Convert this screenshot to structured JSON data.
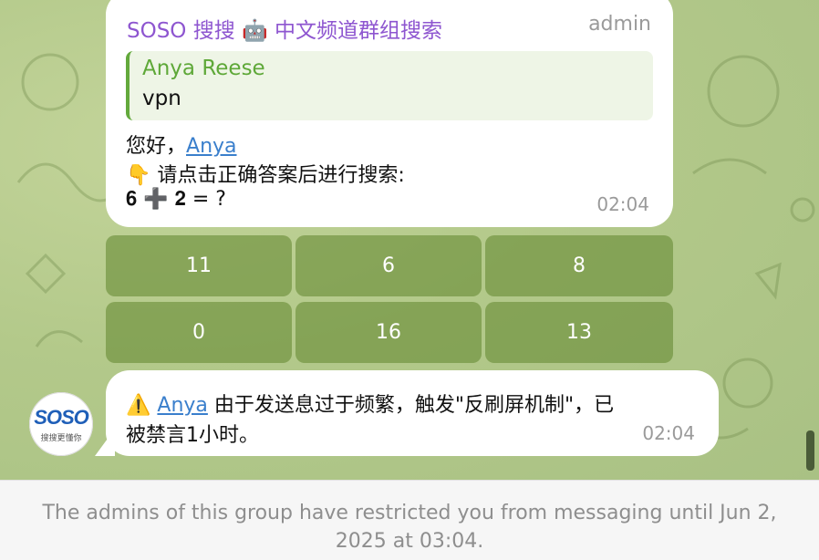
{
  "colors": {
    "chat_background": "#b3c98a",
    "sender_name": "#8e56d0",
    "quote_name": "#5ea838",
    "link": "#3a7fcc",
    "keyboard_button": "#698c37"
  },
  "message1": {
    "sender": "SOSO 搜搜 🤖 中文频道群组搜索",
    "role": "admin",
    "reply_quote": {
      "name": "Anya Reese",
      "text": "vpn"
    },
    "greeting_prefix": "您好，",
    "greeting_link": "Anya",
    "instruction": "👇 请点击正确答案后进行搜索:",
    "question": "𝟔 ➕ 𝟐 = ?",
    "time": "02:04"
  },
  "keyboard": {
    "buttons": [
      "11",
      "6",
      "8",
      "0",
      "16",
      "13"
    ]
  },
  "message2": {
    "warning_icon": "⚠️",
    "link": "Anya",
    "line1_rest": " 由于发送息过于频繁，触发\"反刷屏机制\"，已",
    "line2": "被禁言1小时。",
    "time": "02:04"
  },
  "avatar": {
    "logo_text": "SOSO",
    "logo_subtext": "搜搜更懂你"
  },
  "footer": {
    "notice": "The admins of this group have restricted you from messaging until Jun 2, 2025 at 03:04."
  }
}
